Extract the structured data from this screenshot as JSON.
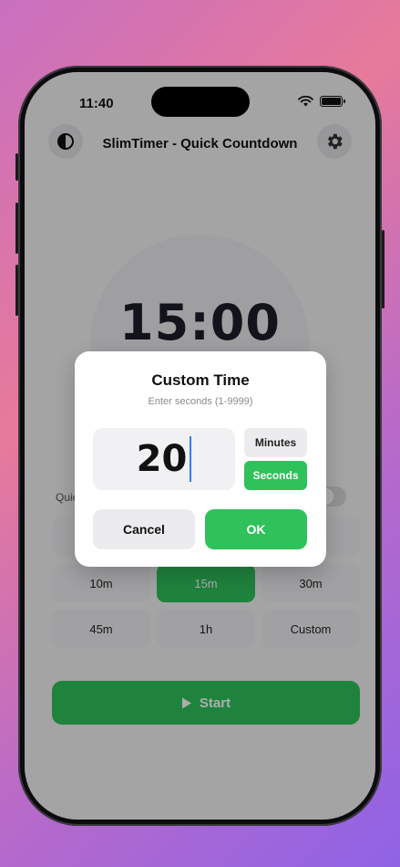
{
  "status": {
    "time": "11:40"
  },
  "header": {
    "title": "SlimTimer - Quick Countdown",
    "theme_icon": "contrast-icon",
    "settings_icon": "gear-icon"
  },
  "timer": {
    "display": "15:00"
  },
  "quick_section": {
    "label": "Quick"
  },
  "presets": [
    {
      "label": "",
      "active": false
    },
    {
      "label": "",
      "active": false
    },
    {
      "label": "",
      "active": false
    },
    {
      "label": "10m",
      "active": false
    },
    {
      "label": "15m",
      "active": true
    },
    {
      "label": "30m",
      "active": false
    },
    {
      "label": "45m",
      "active": false
    },
    {
      "label": "1h",
      "active": false
    },
    {
      "label": "Custom",
      "active": false
    }
  ],
  "start_button": {
    "label": "Start",
    "icon": "play-icon"
  },
  "dialog": {
    "title": "Custom Time",
    "subtitle": "Enter seconds (1-9999)",
    "value": "20",
    "unit_minutes": "Minutes",
    "unit_seconds": "Seconds",
    "selected_unit": "Seconds",
    "cancel_label": "Cancel",
    "ok_label": "OK"
  },
  "colors": {
    "accent": "#2fc15a",
    "caret": "#2d7ff9",
    "clock_text": "#1c1c2a"
  }
}
